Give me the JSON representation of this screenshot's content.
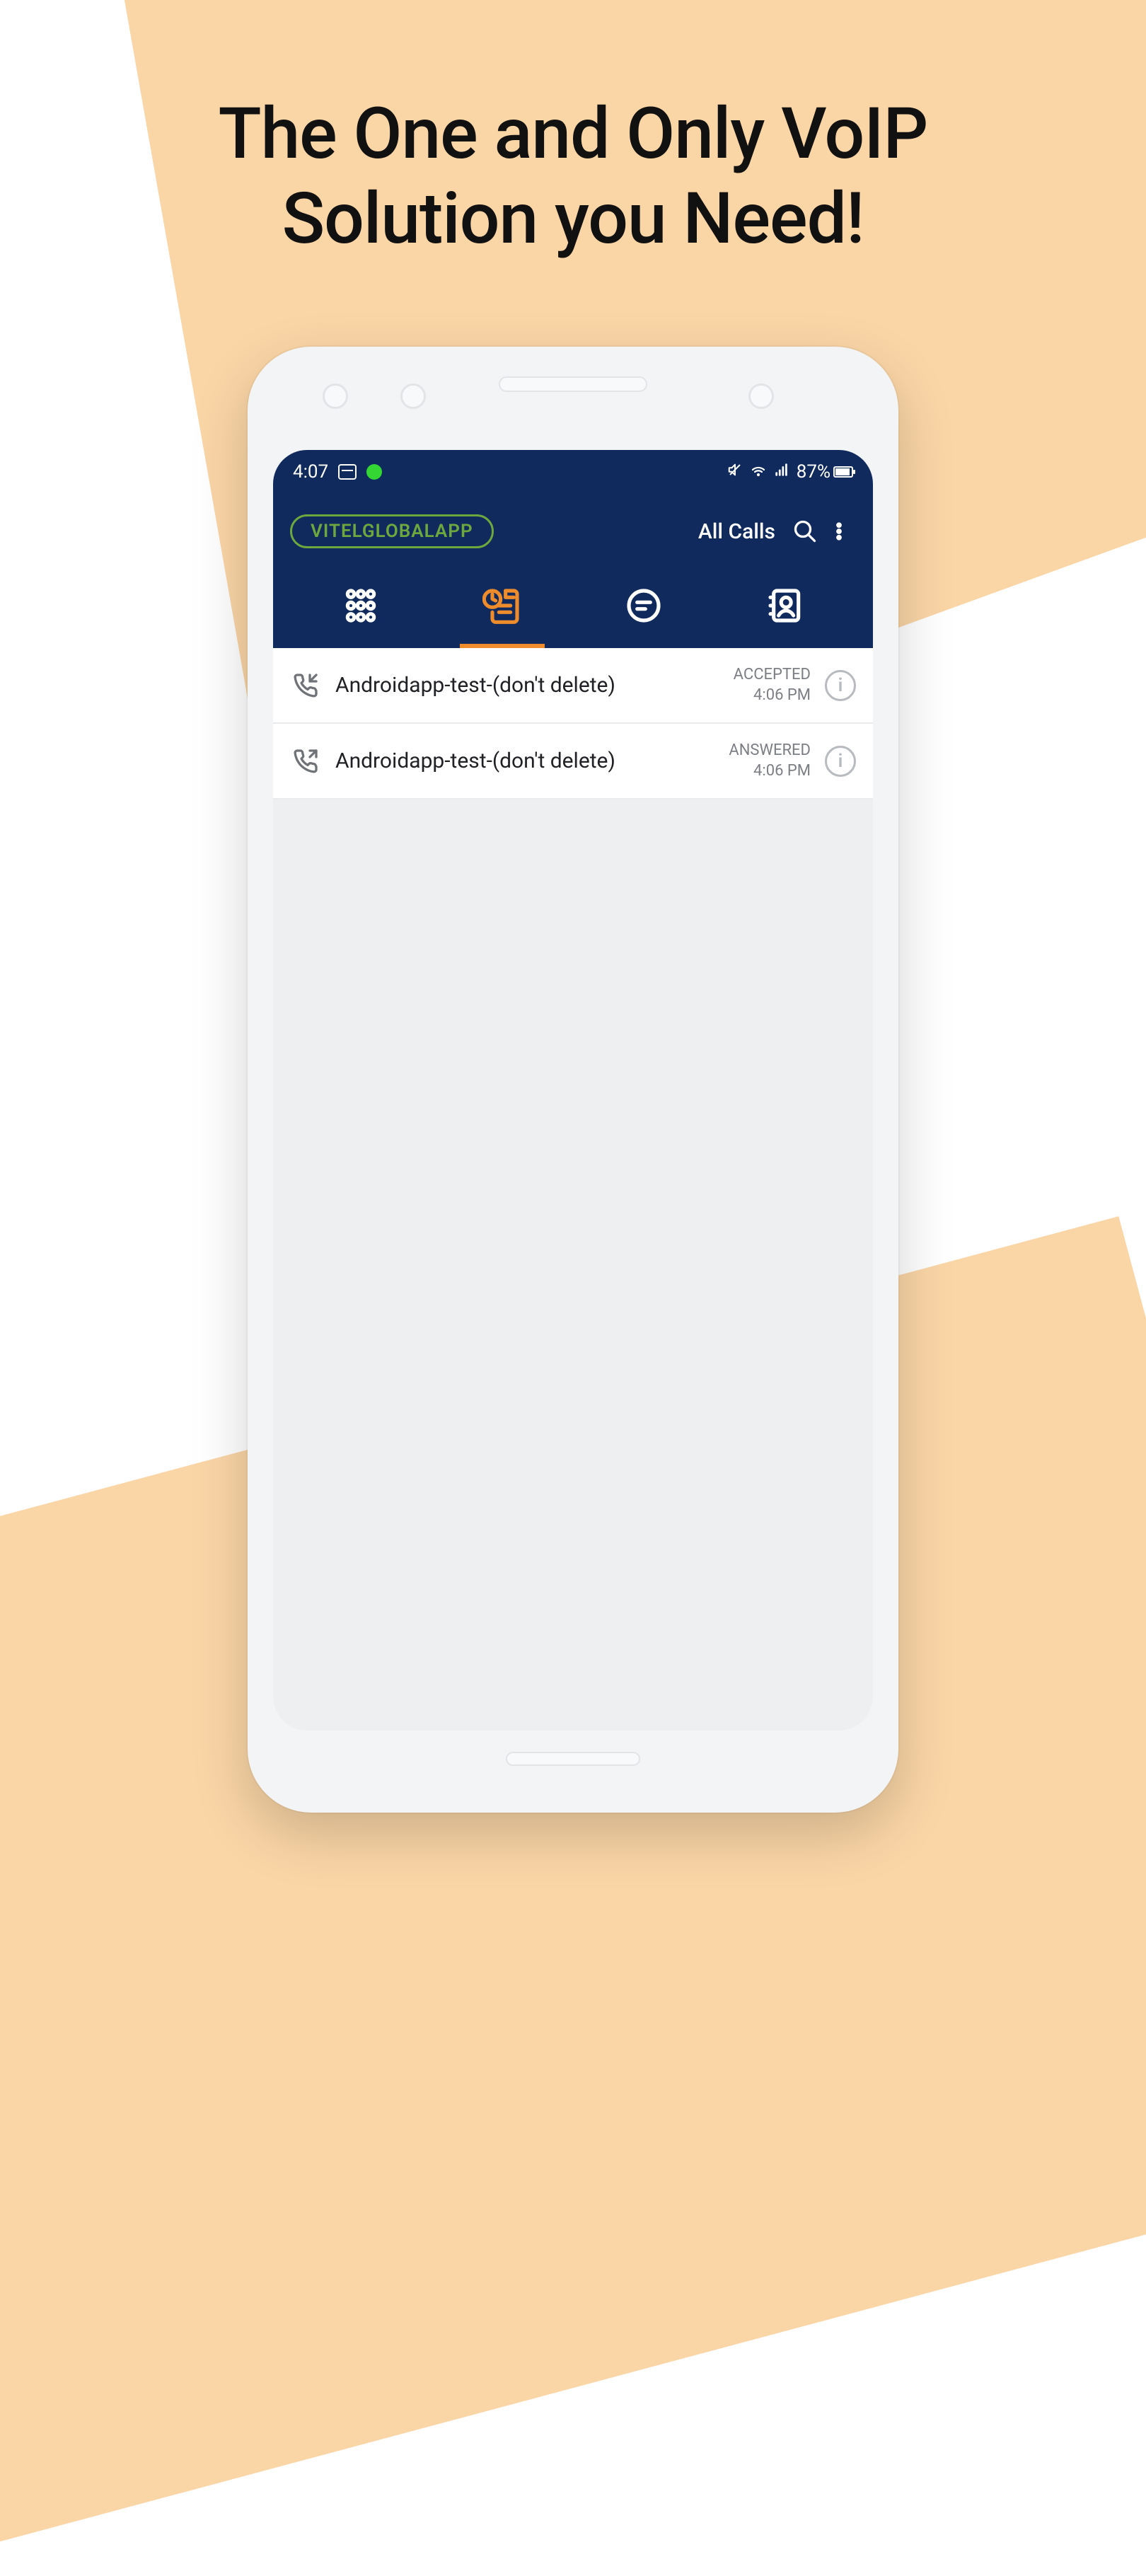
{
  "headline": {
    "line1": "The One and Only VoIP",
    "line2": "Solution you Need!"
  },
  "statusbar": {
    "time": "4:07",
    "battery": "87%"
  },
  "appbar": {
    "chip": "VITELGLOBALAPP",
    "filter": "All Calls"
  },
  "tabs": {
    "dialpad": "dialpad",
    "history": "history",
    "chat": "chat",
    "contacts": "contacts"
  },
  "calls": {
    "0": {
      "name": "Androidapp-test-(don't delete)",
      "status": "ACCEPTED",
      "time": "4:06 PM",
      "direction": "incoming"
    },
    "1": {
      "name": "Androidapp-test-(don't delete)",
      "status": "ANSWERED",
      "time": "4:06 PM",
      "direction": "outgoing"
    }
  }
}
